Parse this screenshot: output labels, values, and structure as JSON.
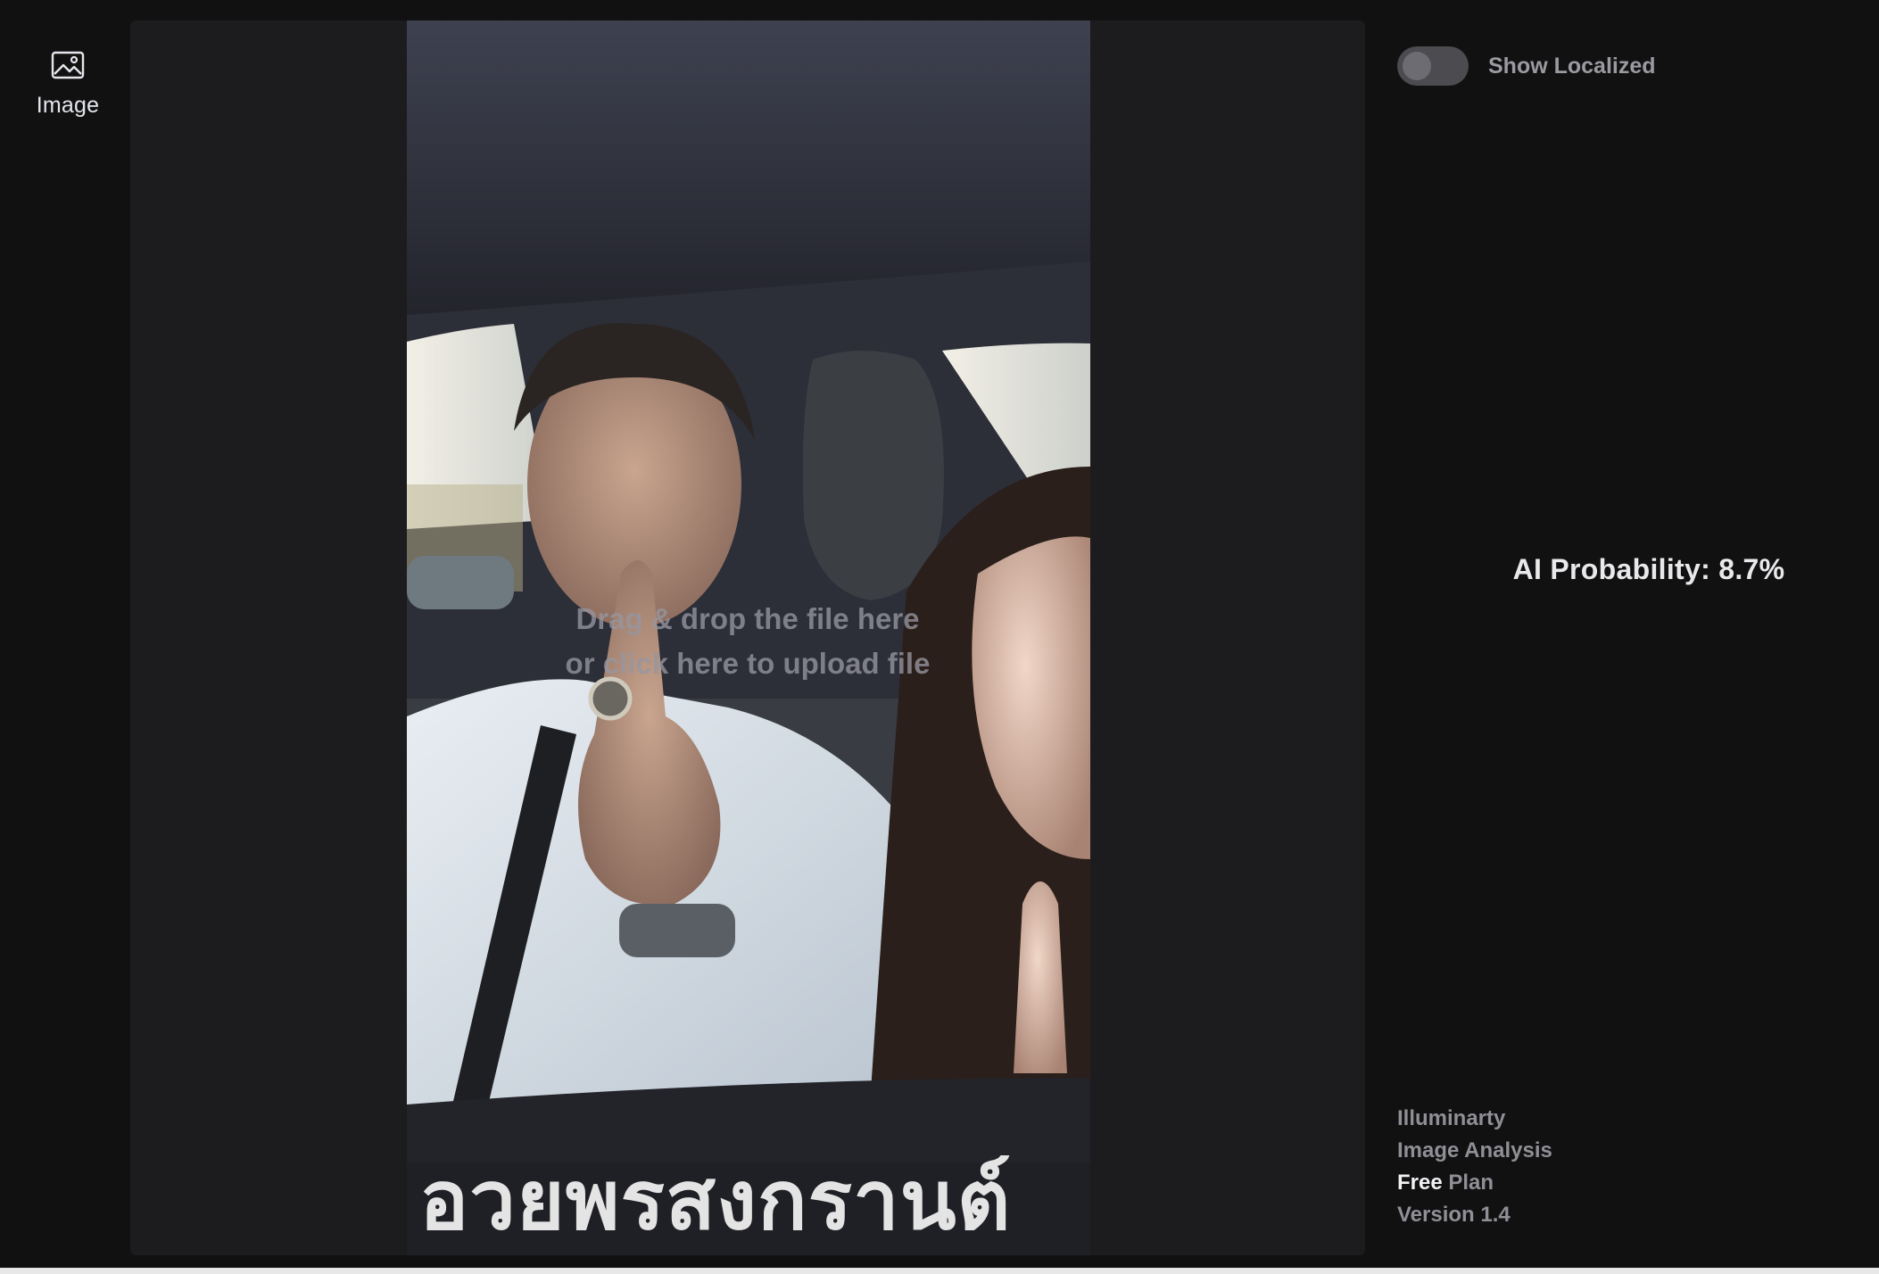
{
  "nav": {
    "items": [
      {
        "label": "Image",
        "icon": "image-icon"
      }
    ]
  },
  "viewer": {
    "drop_line1": "Drag & drop the file here",
    "drop_line2": "or click here to upload file",
    "caption_text": "อวยพรสงกรานต์"
  },
  "side": {
    "toggle_label": "Show Localized",
    "toggle_on": false,
    "ai_probability": "AI Probability: 8.7%"
  },
  "footer": {
    "app_name": "Illuminarty",
    "app_subtitle": "Image Analysis",
    "plan_tier": "Free",
    "plan_suffix": " Plan",
    "version": "Version 1.4"
  },
  "colors": {
    "background": "#111112",
    "panel": "#1c1c1e",
    "accent_text": "#e9e9ec"
  }
}
